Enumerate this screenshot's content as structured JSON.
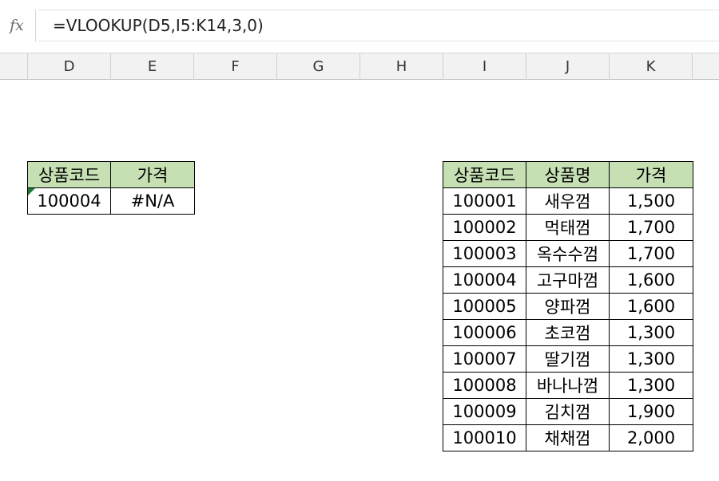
{
  "formula_bar": {
    "fx_label": "fx",
    "formula": "=VLOOKUP(D5,I5:K14,3,0)"
  },
  "columns": [
    "D",
    "E",
    "F",
    "G",
    "H",
    "I",
    "J",
    "K"
  ],
  "lookup_table": {
    "headers": [
      "상품코드",
      "가격"
    ],
    "row": {
      "code": "100004",
      "price": "#N/A"
    }
  },
  "source_table": {
    "headers": [
      "상품코드",
      "상품명",
      "가격"
    ],
    "rows": [
      {
        "code": "100001",
        "name": "새우껌",
        "price": "1,500"
      },
      {
        "code": "100002",
        "name": "먹태껌",
        "price": "1,700"
      },
      {
        "code": "100003",
        "name": "옥수수껌",
        "price": "1,700"
      },
      {
        "code": "100004",
        "name": "고구마껌",
        "price": "1,600"
      },
      {
        "code": "100005",
        "name": "양파껌",
        "price": "1,600"
      },
      {
        "code": "100006",
        "name": "초코껌",
        "price": "1,300"
      },
      {
        "code": "100007",
        "name": "딸기껌",
        "price": "1,300"
      },
      {
        "code": "100008",
        "name": "바나나껌",
        "price": "1,300"
      },
      {
        "code": "100009",
        "name": "김치껌",
        "price": "1,900"
      },
      {
        "code": "100010",
        "name": "채채껌",
        "price": "2,000"
      }
    ]
  },
  "colors": {
    "header_fill": "#c6e0b4",
    "error_indicator": "#1f7a3a",
    "column_header_bg": "#f2f2f2"
  }
}
